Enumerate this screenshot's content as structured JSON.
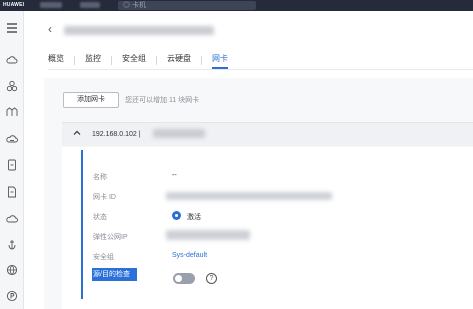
{
  "topbar": {
    "brand": "HUAWEI",
    "search_placeholder": "◎ 卡机"
  },
  "header": {
    "back_glyph": "‹"
  },
  "tabs": [
    {
      "label": "概览",
      "active": false
    },
    {
      "label": "监控",
      "active": false
    },
    {
      "label": "安全组",
      "active": false
    },
    {
      "label": "云硬盘",
      "active": false
    },
    {
      "label": "网卡",
      "active": true
    }
  ],
  "nic": {
    "add_button": "添加网卡",
    "add_hint": "您还可以增加 11 块网卡",
    "ip_prefix": "192.168.0.102 |",
    "fields": {
      "name_label": "名称",
      "name_value": "--",
      "nic_id_label": "网卡 ID",
      "status_label": "状态",
      "status_value": "激活",
      "eip_label": "弹性公网IP",
      "sg_label": "安全组",
      "sg_value": "Sys-default",
      "check_label": "源/目的检查",
      "check_enabled": false
    }
  },
  "colors": {
    "accent": "#2a70d8",
    "topbar": "#252b3a"
  }
}
